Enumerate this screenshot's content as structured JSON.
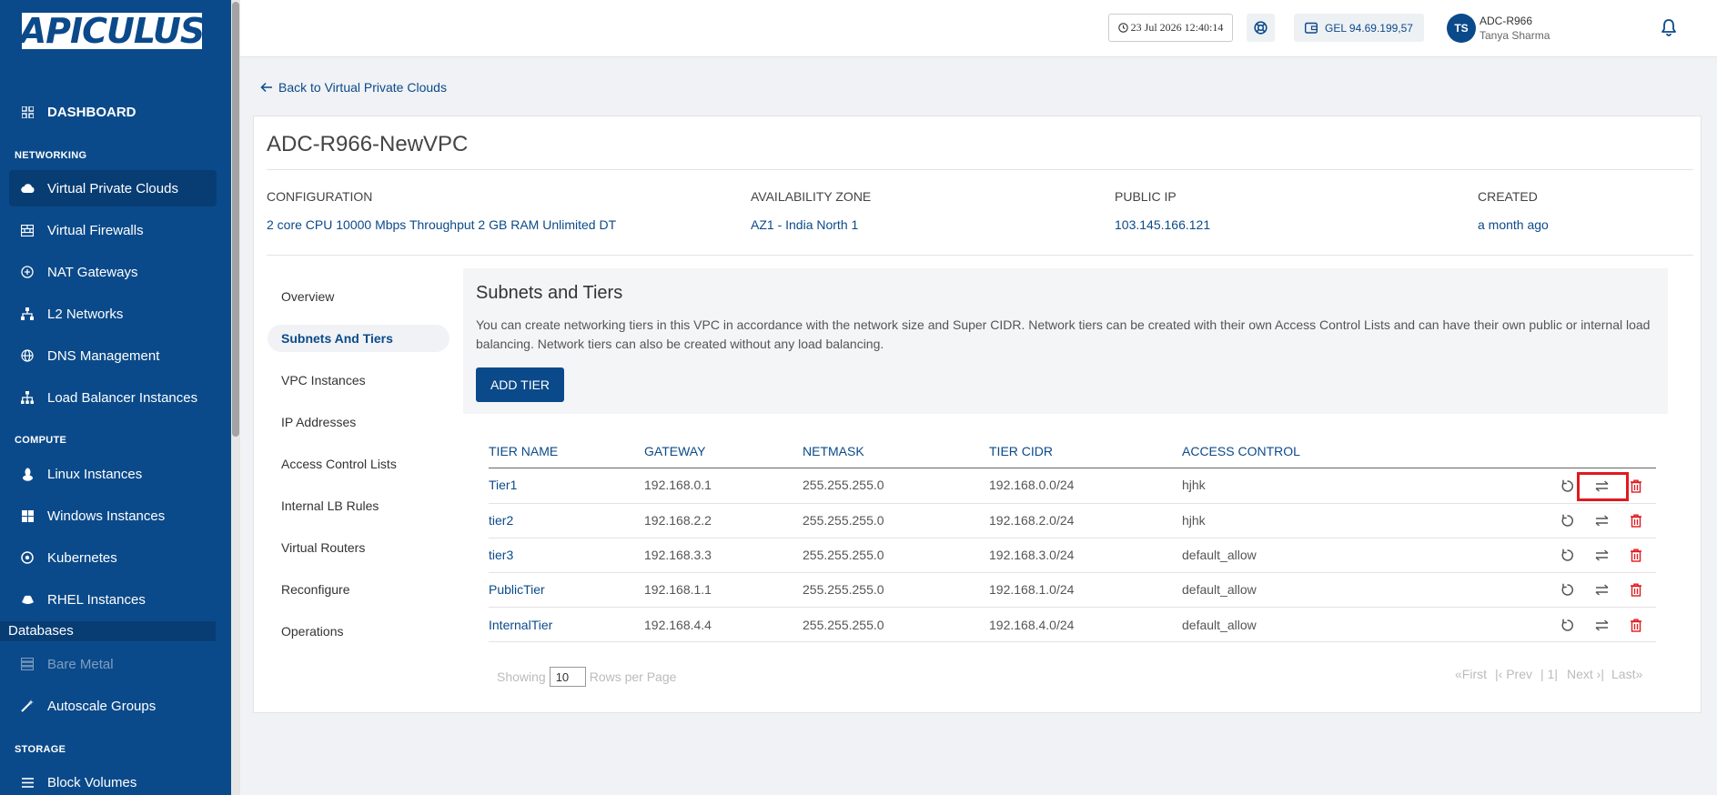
{
  "brand": {
    "logo_text": "APICULUS"
  },
  "sidebar": {
    "dashboard": "DASHBOARD",
    "networking_label": "NETWORKING",
    "compute_label": "COMPUTE",
    "storage_label": "STORAGE",
    "databases_label": "Databases",
    "items": {
      "vpc": "Virtual Private Clouds",
      "firewalls": "Virtual Firewalls",
      "nat": "NAT Gateways",
      "l2": "L2 Networks",
      "dns": "DNS Management",
      "lb": "Load Balancer Instances",
      "linux": "Linux Instances",
      "windows": "Windows Instances",
      "kubernetes": "Kubernetes",
      "rhel": "RHEL Instances",
      "baremetal": "Bare Metal",
      "autoscale": "Autoscale Groups",
      "block": "Block Volumes"
    }
  },
  "header": {
    "datetime": "23 Jul 2026 12:40:14",
    "balance": "GEL 94.69.199,57",
    "avatar_initials": "TS",
    "account": "ADC-R966",
    "user": "Tanya Sharma"
  },
  "back_link": "Back to Virtual Private Clouds",
  "vpc": {
    "name": "ADC-R966-NewVPC",
    "configuration_label": "CONFIGURATION",
    "configuration": "2 core CPU 10000 Mbps Throughput 2 GB RAM Unlimited DT",
    "zone_label": "AVAILABILITY ZONE",
    "zone": "AZ1 - India North 1",
    "ip_label": "PUBLIC IP",
    "ip": "103.145.166.121",
    "created_label": "CREATED",
    "created": "a month ago"
  },
  "tabs": {
    "overview": "Overview",
    "subnets": "Subnets And Tiers",
    "instances": "VPC Instances",
    "ips": "IP Addresses",
    "acl": "Access Control Lists",
    "lbrules": "Internal LB Rules",
    "routers": "Virtual Routers",
    "reconfigure": "Reconfigure",
    "operations": "Operations"
  },
  "panel": {
    "title": "Subnets and Tiers",
    "desc": "You can create networking tiers in this VPC in accordance with the network size and Super CIDR. Network tiers can be created with their own Access Control Lists and can have their own public or internal load balancing. Network tiers can also be created without any load balancing.",
    "add_button": "ADD TIER"
  },
  "table": {
    "headers": {
      "name": "TIER NAME",
      "gateway": "GATEWAY",
      "netmask": "NETMASK",
      "cidr": "TIER CIDR",
      "acl": "ACCESS CONTROL"
    },
    "rows": [
      {
        "name": "Tier1",
        "gateway": "192.168.0.1",
        "netmask": "255.255.255.0",
        "cidr": "192.168.0.0/24",
        "acl": "hjhk"
      },
      {
        "name": "tier2",
        "gateway": "192.168.2.2",
        "netmask": "255.255.255.0",
        "cidr": "192.168.2.0/24",
        "acl": "hjhk"
      },
      {
        "name": "tier3",
        "gateway": "192.168.3.3",
        "netmask": "255.255.255.0",
        "cidr": "192.168.3.0/24",
        "acl": "default_allow"
      },
      {
        "name": "PublicTier",
        "gateway": "192.168.1.1",
        "netmask": "255.255.255.0",
        "cidr": "192.168.1.0/24",
        "acl": "default_allow"
      },
      {
        "name": "InternalTier",
        "gateway": "192.168.4.4",
        "netmask": "255.255.255.0",
        "cidr": "192.168.4.0/24",
        "acl": "default_allow"
      }
    ]
  },
  "pagination": {
    "showing": "Showing",
    "rows_value": "10",
    "rows_per_page": "Rows per Page",
    "first": "«First",
    "prev": "|‹ Prev",
    "page": "| 1|",
    "next": "Next ›|",
    "last": "Last»"
  },
  "colors": {
    "primary": "#0b4a8a",
    "danger": "#e0191f"
  }
}
